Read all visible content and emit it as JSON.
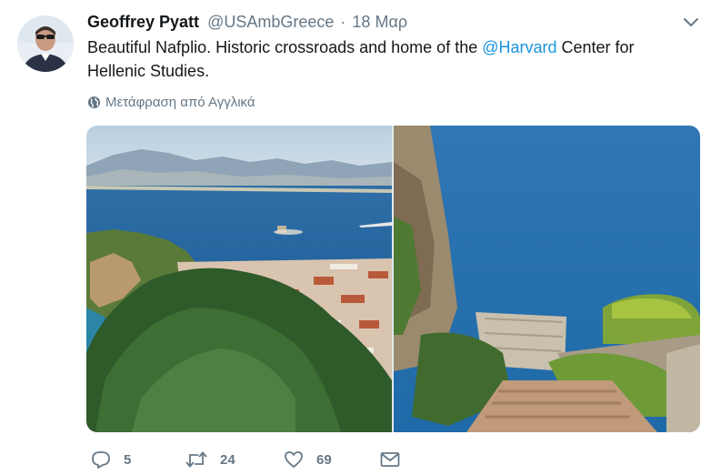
{
  "author": {
    "name": "Geoffrey Pyatt",
    "handle": "@USAmbGreece",
    "separator": "·",
    "date": "18 Μαρ"
  },
  "tweet": {
    "text_before": "Beautiful Nafplio.  Historic crossroads and home of the ",
    "mention": "@Harvard",
    "text_after": " Center for Hellenic Studies."
  },
  "translate": {
    "icon": "globe-icon",
    "label": "Μετάφραση από Αγγλικά"
  },
  "media": {
    "photos": [
      "nafplio-panorama-photo",
      "cliff-stairway-sea-photo"
    ]
  },
  "actions": {
    "reply_count": "5",
    "retweet_count": "24",
    "like_count": "69"
  },
  "colors": {
    "link": "#1b95e0",
    "secondary_text": "#657786",
    "primary_text": "#14171a"
  }
}
